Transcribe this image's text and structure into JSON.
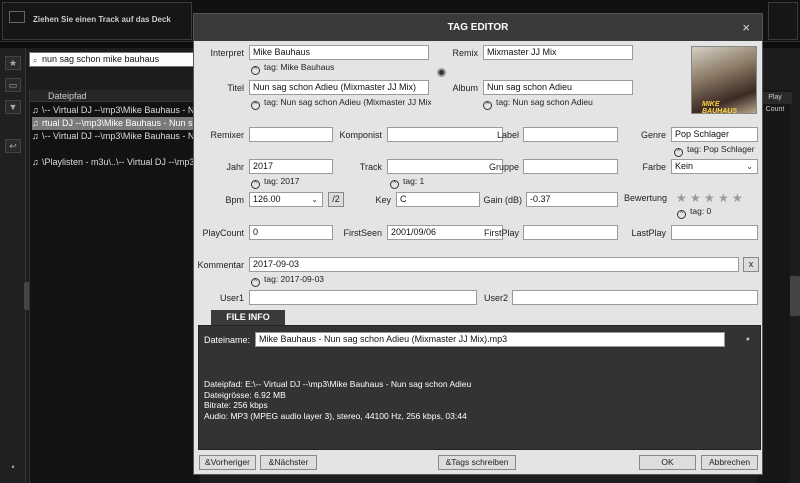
{
  "background": {
    "deck_text": "Ziehen Sie einen Track auf das Deck",
    "search_value": "nun sag schon mike bauhaus",
    "column_header": "Dateipfad",
    "rows": [
      "\\-- Virtual DJ --\\mp3\\Mike Bauhaus - Nun sag schon Adieu",
      "rtual DJ --\\mp3\\Mike Bauhaus - Nun sag schon Adieu",
      "\\-- Virtual DJ --\\mp3\\Mike Bauhaus - Nun sag schon Adieu",
      "\\Playlisten - m3u\\..\\-- Virtual DJ --\\mp3\\Mike Bauhaus"
    ],
    "play_count_header": "Play Count"
  },
  "dialog": {
    "title": "TAG EDITOR",
    "close": "×",
    "interpret": {
      "label": "Interpret",
      "value": "Mike Bauhaus",
      "tag": "tag: Mike Bauhaus"
    },
    "titel": {
      "label": "Titel",
      "value": "Nun sag schon Adieu (Mixmaster JJ Mix)",
      "tag": "tag: Nun sag schon Adieu (Mixmaster JJ Mix)"
    },
    "remix": {
      "label": "Remix",
      "value": "Mixmaster JJ Mix"
    },
    "album": {
      "label": "Album",
      "value": "Nun sag schon Adieu",
      "tag": "tag: Nun sag schon Adieu"
    },
    "cover_text": "MIKE BAUHAUS",
    "remixer": {
      "label": "Remixer",
      "value": ""
    },
    "komponist": {
      "label": "Komponist",
      "value": ""
    },
    "label_field": {
      "label": "Label",
      "value": ""
    },
    "genre": {
      "label": "Genre",
      "value": "Pop Schlager",
      "tag": "tag: Pop Schlager"
    },
    "jahr": {
      "label": "Jahr",
      "value": "2017",
      "tag": "tag: 2017"
    },
    "track": {
      "label": "Track",
      "value": "",
      "tag": "tag: 1"
    },
    "gruppe": {
      "label": "Gruppe",
      "value": ""
    },
    "farbe": {
      "label": "Farbe",
      "value": "Kein"
    },
    "bpm": {
      "label": "Bpm",
      "value": "126.00",
      "half_button": "/2"
    },
    "key": {
      "label": "Key",
      "value": "C"
    },
    "gain": {
      "label": "Gain (dB)",
      "value": "-0.37"
    },
    "bewertung": {
      "label": "Bewertung",
      "stars": 0,
      "tag": "tag: 0"
    },
    "playcount": {
      "label": "PlayCount",
      "value": "0"
    },
    "firstseen": {
      "label": "FirstSeen",
      "value": "2001/09/06"
    },
    "firstplay": {
      "label": "FirstPlay",
      "value": ""
    },
    "lastplay": {
      "label": "LastPlay",
      "value": ""
    },
    "kommentar": {
      "label": "Kommentar",
      "value": "2017-09-03",
      "tag": "tag: 2017-09-03",
      "clear": "x"
    },
    "user1": {
      "label": "User1",
      "value": ""
    },
    "user2": {
      "label": "User2",
      "value": ""
    },
    "file_info": {
      "tab": "FILE INFO",
      "dateiname_label": "Dateiname:",
      "dateiname": "Mike Bauhaus - Nun sag schon Adieu (Mixmaster JJ Mix).mp3",
      "dateipfad": "Dateipfad: E:\\-- Virtual DJ --\\mp3\\Mike Bauhaus - Nun sag schon Adieu",
      "dateigroesse": "Dateigrösse: 6.92 MB",
      "bitrate": "Bitrate: 256 kbps",
      "audio": "Audio: MP3 (MPEG audio layer 3), stereo, 44100 Hz, 256 kbps, 03:44"
    },
    "buttons": {
      "prev": "&Vorheriger",
      "next": "&Nächster",
      "write_tags": "&Tags schreiben",
      "ok": "OK",
      "cancel": "Abbrechen"
    }
  }
}
